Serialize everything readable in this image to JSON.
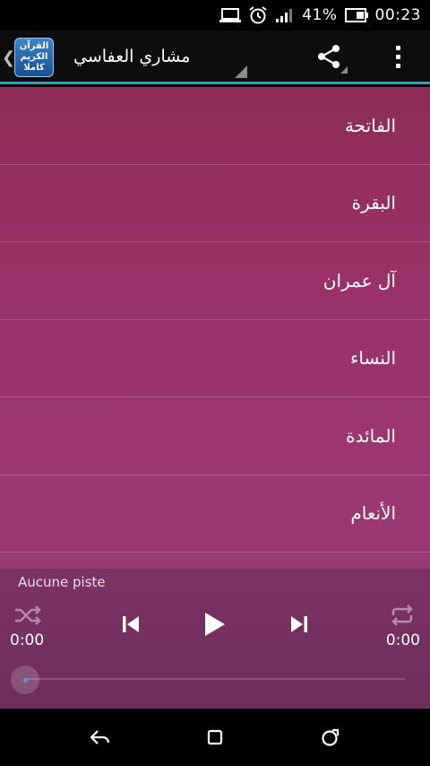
{
  "status_bar": {
    "battery_percent": "41%",
    "time": "00:23",
    "icons": [
      "laptop-icon",
      "alarm-icon",
      "signal-icon",
      "battery-icon"
    ]
  },
  "action_bar": {
    "logo_lines": [
      "القرآن",
      "الكريم",
      "كاملا"
    ],
    "title": "مشاري العفاسي",
    "icons": [
      "back-chevron-icon",
      "share-icon",
      "overflow-menu-icon"
    ]
  },
  "surahs": [
    {
      "label": "الفاتحة"
    },
    {
      "label": "البقرة"
    },
    {
      "label": "آل عمران"
    },
    {
      "label": "النساء"
    },
    {
      "label": "المائدة"
    },
    {
      "label": "الأنعام"
    }
  ],
  "player": {
    "track_label": "Aucune piste",
    "elapsed": "0:00",
    "duration": "0:00",
    "progress": 0,
    "icons": [
      "shuffle-icon",
      "previous-icon",
      "play-icon",
      "next-icon",
      "repeat-icon"
    ]
  },
  "nav_bar": {
    "icons": [
      "back-icon",
      "home-icon",
      "recents-icon"
    ]
  },
  "colors": {
    "accent": "#1ea0d8",
    "list_background": "#9a3168",
    "player_background": "#6e2d5a"
  }
}
